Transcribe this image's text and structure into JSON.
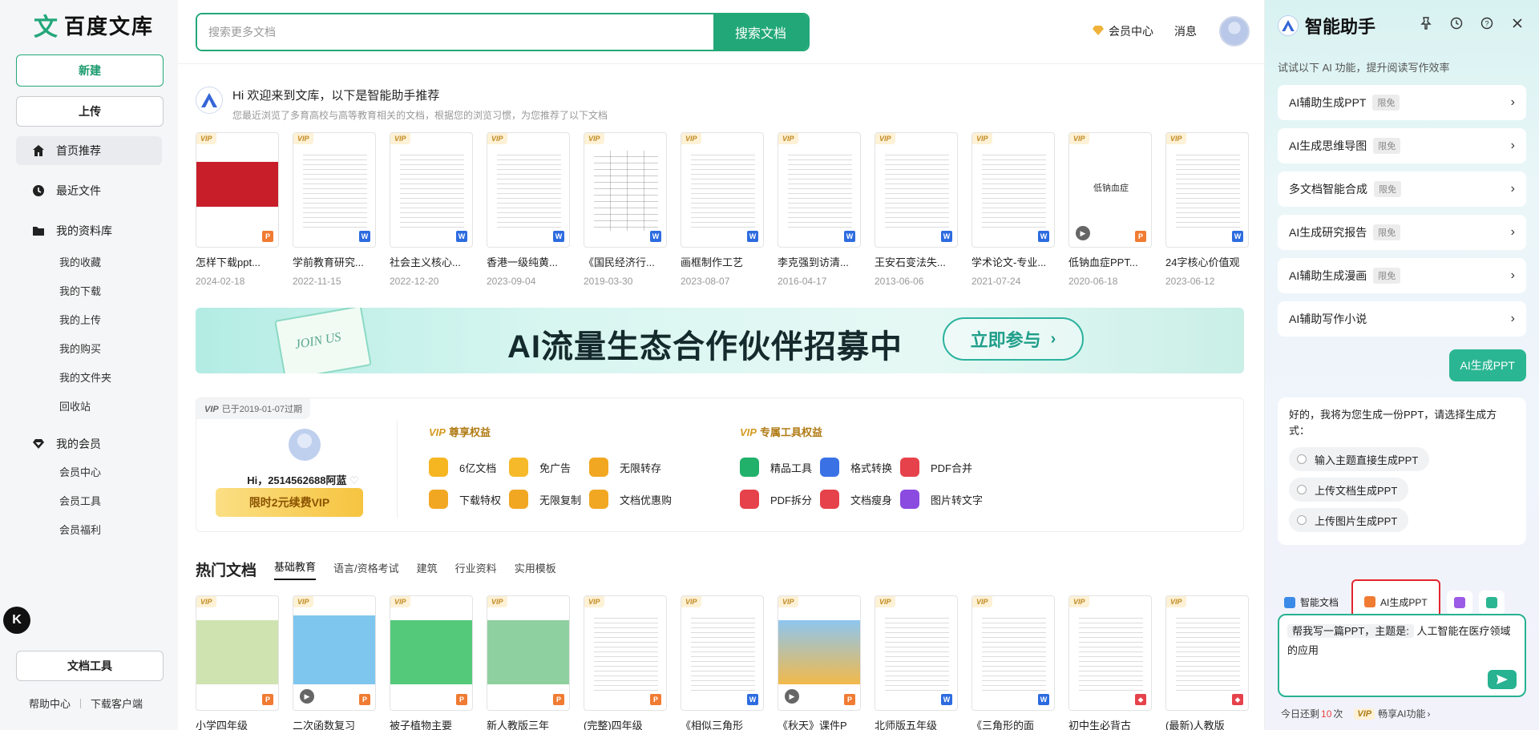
{
  "sidebar": {
    "logo_text": "百度文库",
    "logo_mark": "文",
    "new_label": "新建",
    "upload_label": "上传",
    "nav": [
      {
        "label": "首页推荐",
        "icon": "home-icon"
      },
      {
        "label": "最近文件",
        "icon": "clock-icon"
      },
      {
        "label": "我的资料库",
        "icon": "folder-icon"
      },
      {
        "label": "我的会员",
        "icon": "diamond-icon"
      }
    ],
    "library_sub": [
      "我的收藏",
      "我的下载",
      "我的上传",
      "我的购买",
      "我的文件夹",
      "回收站"
    ],
    "member_sub": [
      "会员中心",
      "会员工具",
      "会员福利"
    ],
    "float_label": "K",
    "doc_tools_label": "文档工具",
    "footer": {
      "help": "帮助中心",
      "download_client": "下载客户端"
    }
  },
  "header": {
    "search_placeholder": "搜索更多文档",
    "search_button": "搜索文档",
    "vip_center": "会员中心",
    "messages": "消息"
  },
  "greeting": {
    "title": "Hi 欢迎来到文库，以下是智能助手推荐",
    "subtitle": "您最近浏览了多育高校与高等教育相关的文档，根据您的浏览习惯，为您推荐了以下文档"
  },
  "recommended_docs": [
    {
      "title": "怎样下载ppt...",
      "date": "2024-02-18",
      "fmt": "P",
      "thumb": "red"
    },
    {
      "title": "学前教育研究...",
      "date": "2022-11-15",
      "fmt": "W",
      "thumb": "text"
    },
    {
      "title": "社会主义核心...",
      "date": "2022-12-20",
      "fmt": "W",
      "thumb": "text"
    },
    {
      "title": "香港一级纯黄...",
      "date": "2023-09-04",
      "fmt": "W",
      "thumb": "text"
    },
    {
      "title": "《国民经济行...",
      "date": "2019-03-30",
      "fmt": "W",
      "thumb": "table"
    },
    {
      "title": "画框制作工艺",
      "date": "2023-08-07",
      "fmt": "W",
      "thumb": "text"
    },
    {
      "title": "李克强到访清...",
      "date": "2016-04-17",
      "fmt": "W",
      "thumb": "text"
    },
    {
      "title": "王安石变法失...",
      "date": "2013-06-06",
      "fmt": "W",
      "thumb": "text"
    },
    {
      "title": "学术论文-专业...",
      "date": "2021-07-24",
      "fmt": "W",
      "thumb": "text"
    },
    {
      "title": "低钠血症PPT...",
      "date": "2020-06-18",
      "fmt": "P",
      "thumb": "plain",
      "thumb_text": "低钠血症"
    },
    {
      "title": "24字核心价值观",
      "date": "2023-06-12",
      "fmt": "W",
      "thumb": "text"
    }
  ],
  "vip_tag": "VIP",
  "banner": {
    "envelope_text": "JOIN US",
    "headline": "AI流量生态合作伙伴招募中",
    "cta": "立即参与"
  },
  "vip_panel": {
    "expiry": "已于2019-01-07过期",
    "username": "Hi，2514562688阿蓝",
    "renew_button": "限时2元续费VIP",
    "section1_title": "尊享权益",
    "section2_title": "专属工具权益",
    "benefits": [
      {
        "label": "6亿文档",
        "color": "#f6b622"
      },
      {
        "label": "免广告",
        "color": "#f5b92a"
      },
      {
        "label": "无限转存",
        "color": "#f2a722"
      },
      {
        "label": "下载特权",
        "color": "#f2a722"
      },
      {
        "label": "无限复制",
        "color": "#f2a722"
      },
      {
        "label": "文档优惠购",
        "color": "#f2a722"
      }
    ],
    "tools": [
      {
        "label": "精品工具",
        "color": "#21b16a"
      },
      {
        "label": "格式转换",
        "color": "#3a72e6"
      },
      {
        "label": "PDF合并",
        "color": "#e6424b"
      },
      {
        "label": "PDF拆分",
        "color": "#e6424b"
      },
      {
        "label": "文档瘦身",
        "color": "#e6424b"
      },
      {
        "label": "图片转文字",
        "color": "#8b4ae0"
      }
    ]
  },
  "hot": {
    "title": "热门文档",
    "tabs": [
      "基础教育",
      "语言/资格考试",
      "建筑",
      "行业资料",
      "实用模板"
    ],
    "docs": [
      {
        "title": "小学四年级",
        "fmt": "P",
        "thumb": "green"
      },
      {
        "title": "二次函数复习",
        "fmt": "P",
        "thumb": "blue"
      },
      {
        "title": "被子植物主要",
        "fmt": "P",
        "thumb": "leaf"
      },
      {
        "title": "新人教版三年",
        "fmt": "P",
        "thumb": "sky"
      },
      {
        "title": "(完整)四年级",
        "fmt": "P",
        "thumb": "text"
      },
      {
        "title": "《相似三角形",
        "fmt": "W",
        "thumb": "text"
      },
      {
        "title": "《秋天》课件P",
        "fmt": "P",
        "thumb": "autumn"
      },
      {
        "title": "北师版五年级",
        "fmt": "W",
        "thumb": "text"
      },
      {
        "title": "《三角形的面",
        "fmt": "W",
        "thumb": "text"
      },
      {
        "title": "初中生必背古",
        "fmt": "PDF",
        "thumb": "text"
      },
      {
        "title": "(最新)人教版",
        "fmt": "PDF",
        "thumb": "text"
      }
    ]
  },
  "assistant": {
    "title": "智能助手",
    "hint": "试试以下 AI 功能，提升阅读写作效率",
    "free_tag": "限免",
    "features": [
      {
        "label": "AI辅助生成PPT",
        "free": true
      },
      {
        "label": "AI生成思维导图",
        "free": true
      },
      {
        "label": "多文档智能合成",
        "free": true
      },
      {
        "label": "AI生成研究报告",
        "free": true
      },
      {
        "label": "AI辅助生成漫画",
        "free": true
      },
      {
        "label": "AI辅助写作小说",
        "free": false
      }
    ],
    "user_message": "AI生成PPT",
    "bot_reply": "好的，我将为您生成一份PPT，请选择生成方式：",
    "options": [
      "输入主题直接生成PPT",
      "上传文档生成PPT",
      "上传图片生成PPT"
    ],
    "chips": {
      "smart_doc": "智能文档",
      "ai_ppt": "AI生成PPT"
    },
    "input": {
      "prefix": "帮我写一篇PPT，主题是:",
      "topic": "人工智能在医疗领域的应用"
    },
    "footer": {
      "prefix": "今日还剩",
      "count": "10",
      "suffix": "次",
      "vip_label": "VIP",
      "link": "畅享AI功能"
    }
  },
  "colors": {
    "brand": "#22a878",
    "highlight": "#e3262e",
    "vip_gold": "#b07b14"
  }
}
